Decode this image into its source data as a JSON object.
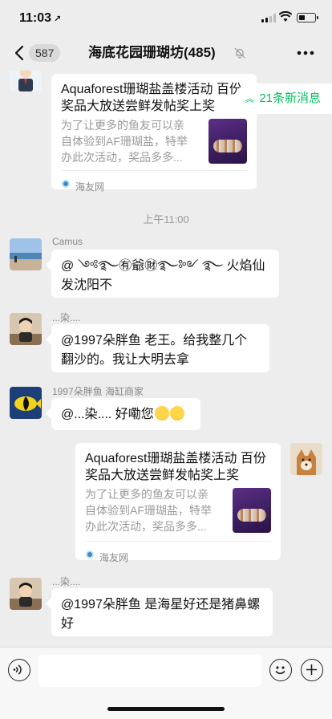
{
  "status_bar": {
    "time": "11:03",
    "location_arrow": "↗"
  },
  "nav": {
    "back_icon": "chevron-left-icon",
    "unread_count": "587",
    "title": "海底花园珊瑚坊(485)",
    "mute_icon": "bell-off-icon",
    "more_icon": "more-icon"
  },
  "new_messages_badge": "21条新消息",
  "messages": [
    {
      "type": "card",
      "side": "left",
      "title": "Aquaforest珊瑚盐盖楼活动 百份奖品大放送尝鲜发帖奖上奖",
      "desc": "为了让更多的鱼友可以亲自体验到AF珊瑚盐，特举办此次活动，奖品多多...",
      "source": "海友网"
    },
    {
      "type": "time",
      "text": "上午11:00"
    },
    {
      "type": "text",
      "side": "left",
      "sender": "Camus",
      "text": "@ ༺࿐㊒爺㊖࿐༻ ࿐ 火焰仙发沈阳不"
    },
    {
      "type": "text",
      "side": "left",
      "sender": "...染....",
      "text": "@1997朵胖鱼 老王。给我整几个翻沙的。我让大明去拿"
    },
    {
      "type": "text",
      "side": "left",
      "sender": "1997朵胖鱼 海缸商家",
      "text": "@...染.... 好嘞您"
    },
    {
      "type": "card",
      "side": "right",
      "title": "Aquaforest珊瑚盐盖楼活动 百份奖品大放送尝鲜发帖奖上奖",
      "desc": "为了让更多的鱼友可以亲自体验到AF珊瑚盐，特举办此次活动，奖品多多...",
      "source": "海友网"
    },
    {
      "type": "text",
      "side": "left",
      "sender": "...染....",
      "text": "@1997朵胖鱼  是海星好还是猪鼻螺好"
    }
  ],
  "input_bar": {
    "voice_icon": "voice-icon",
    "emoji_icon": "emoji-icon",
    "plus_icon": "plus-icon",
    "input_value": ""
  },
  "colors": {
    "background": "#ededed",
    "bubble": "#ffffff",
    "accent_green": "#07c160",
    "secondary_text": "#888888"
  }
}
